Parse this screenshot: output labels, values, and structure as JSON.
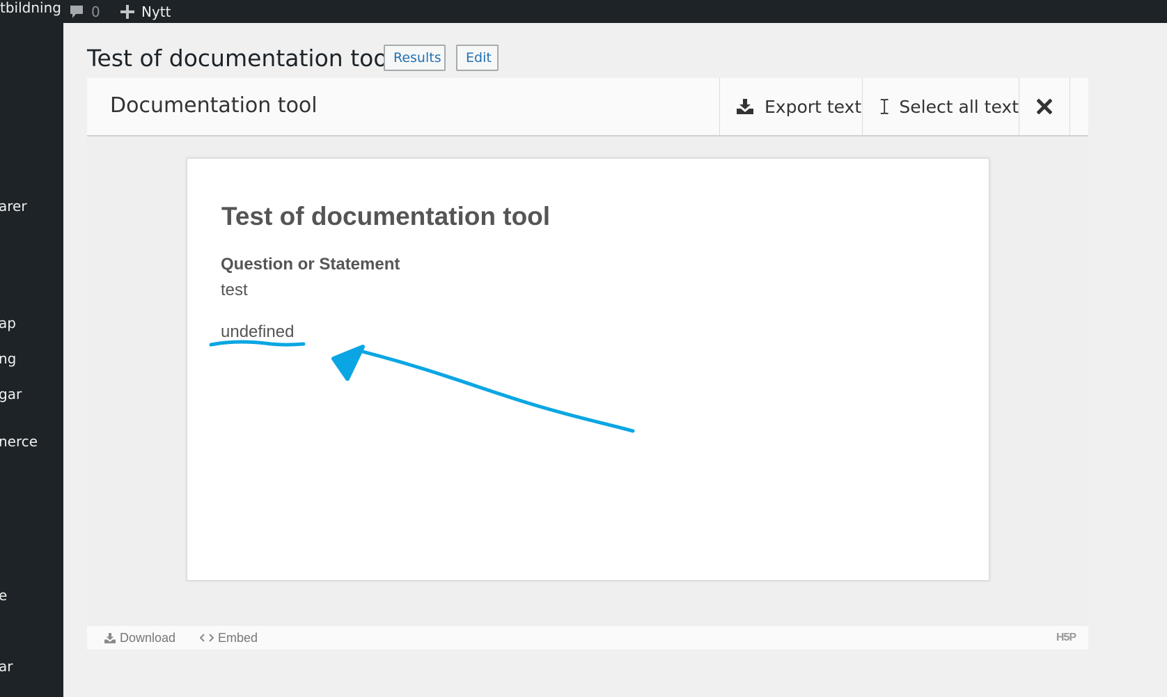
{
  "adminbar": {
    "site_name": "tbildning",
    "comments_count": "0",
    "new_label": "Nytt"
  },
  "sidemenu": {
    "items": [
      "arer",
      "ap",
      "ng",
      "gar",
      "nerce",
      "e",
      "ar"
    ]
  },
  "header": {
    "title": "Test of documentation tool",
    "results_label": "Results",
    "edit_label": "Edit"
  },
  "toolbar": {
    "title": "Documentation tool",
    "export_label": "Export text",
    "select_all_label": "Select all text"
  },
  "document": {
    "title": "Test of documentation tool",
    "question_label": "Question or Statement",
    "answer": "test",
    "extra": "undefined"
  },
  "footer": {
    "download_label": "Download",
    "embed_label": "Embed",
    "logo_text": "H5P"
  },
  "colors": {
    "annotation": "#0aa6e3",
    "link": "#2271b1",
    "adminbar": "#1d2327"
  }
}
